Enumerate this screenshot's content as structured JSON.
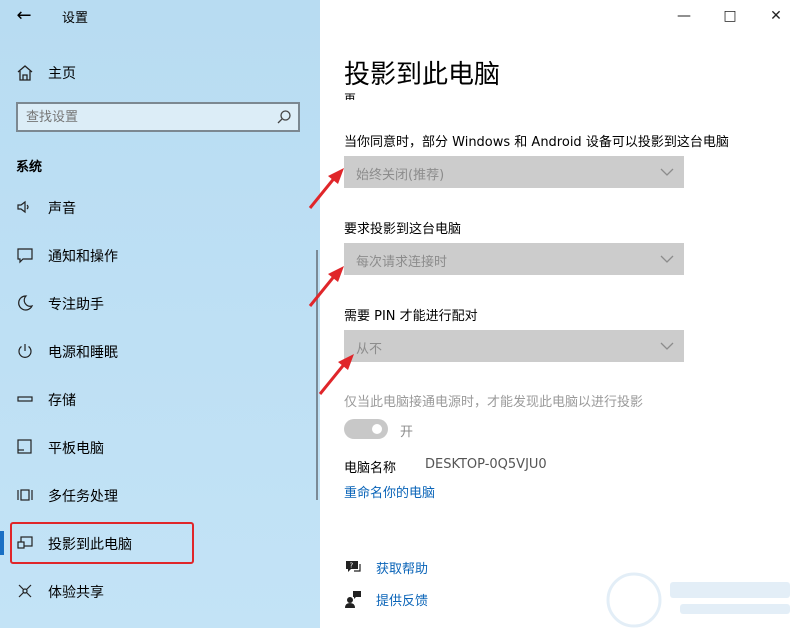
{
  "window": {
    "title": "设置",
    "controls": [
      "minimize",
      "maximize",
      "close"
    ]
  },
  "sidebar": {
    "home_label": "主页",
    "search_placeholder": "查找设置",
    "section": "系统",
    "items": [
      {
        "label": "声音",
        "icon": "speaker-icon"
      },
      {
        "label": "通知和操作",
        "icon": "notification-icon"
      },
      {
        "label": "专注助手",
        "icon": "moon-icon"
      },
      {
        "label": "电源和睡眠",
        "icon": "power-icon"
      },
      {
        "label": "存储",
        "icon": "storage-icon"
      },
      {
        "label": "平板电脑",
        "icon": "tablet-icon"
      },
      {
        "label": "多任务处理",
        "icon": "multitask-icon"
      },
      {
        "label": "投影到此电脑",
        "icon": "projection-icon",
        "active": true
      },
      {
        "label": "体验共享",
        "icon": "share-icon"
      }
    ]
  },
  "main": {
    "title": "投影到此电脑",
    "cut_text": "再。",
    "settings": [
      {
        "label": "当你同意时，部分 Windows 和 Android 设备可以投影到这台电脑",
        "value": "始终关闭(推荐)"
      },
      {
        "label": "要求投影到这台电脑",
        "value": "每次请求连接时"
      },
      {
        "label": "需要 PIN 才能进行配对",
        "value": "从不"
      }
    ],
    "power_option": {
      "label": "仅当此电脑接通电源时，才能发现此电脑以进行投影",
      "toggle_state": "开",
      "on": true
    },
    "pc_name": {
      "label": "电脑名称",
      "value": "DESKTOP-0Q5VJU0"
    },
    "rename_link": "重命名你的电脑",
    "help": {
      "get_help": "获取帮助",
      "feedback": "提供反馈"
    }
  },
  "colors": {
    "sidebar_bg": "#b8dcf2",
    "accent": "#1a6fc4",
    "link": "#0a64b8",
    "highlight_box": "#e0262a",
    "annotation_arrow": "#e0262a",
    "dropdown_bg": "#cccccc"
  }
}
